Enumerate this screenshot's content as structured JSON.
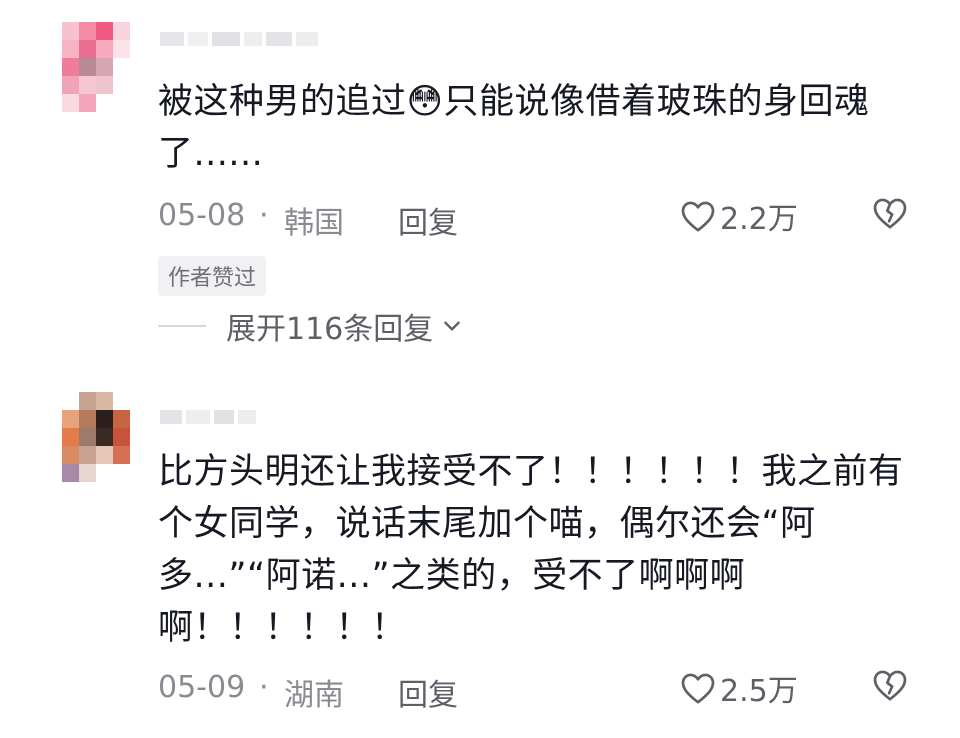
{
  "comments": [
    {
      "text": "被这种男的追过😳只能说像借着玻珠的身回魂了......",
      "date": "05-08",
      "separator": "·",
      "location": "韩国",
      "reply_label": "回复",
      "likes": "2.2万",
      "author_badge": "作者赞过",
      "expand_label": "展开116条回复"
    },
    {
      "text": "比方头明还让我接受不了！！！！！！我之前有个女同学，说话末尾加个喵，偶尔还会“阿多...”“阿诺...”之类的，受不了啊啊啊啊！！！！！！",
      "date": "05-09",
      "separator": "·",
      "location": "湖南",
      "reply_label": "回复",
      "likes": "2.5万"
    }
  ],
  "colors": {
    "text": "#161823",
    "meta": "#8a8b91",
    "badge_bg": "#f1f1f3"
  },
  "icons": {
    "like": "heart-outline-icon",
    "dislike": "broken-heart-icon",
    "expand": "chevron-down-icon"
  }
}
